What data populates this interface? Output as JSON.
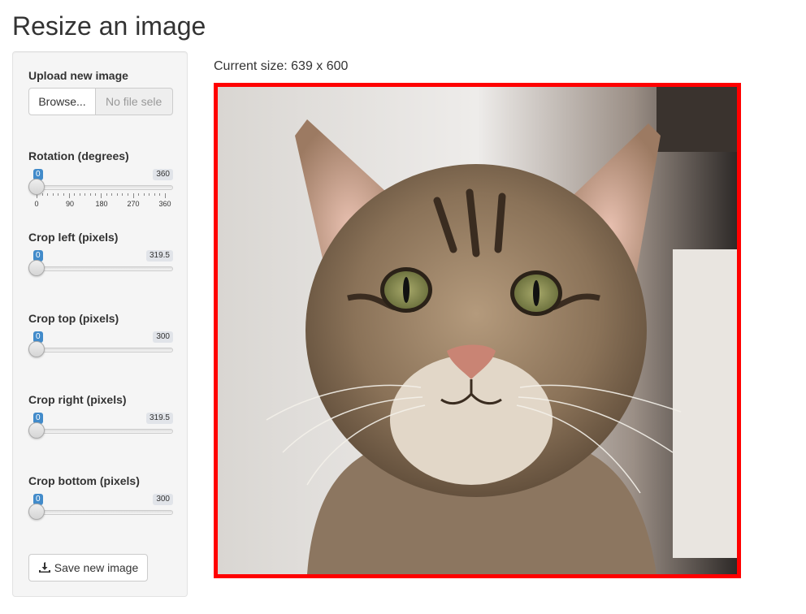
{
  "page": {
    "title": "Resize an image"
  },
  "upload": {
    "label": "Upload new image",
    "browse_label": "Browse...",
    "file_placeholder": "No file sele"
  },
  "rotation": {
    "label": "Rotation (degrees)",
    "min": "0",
    "max": "360",
    "value": 0,
    "ticks": [
      "0",
      "90",
      "180",
      "270",
      "360"
    ]
  },
  "crop_left": {
    "label": "Crop left (pixels)",
    "min": "0",
    "max": "319.5",
    "value": 0
  },
  "crop_top": {
    "label": "Crop top (pixels)",
    "min": "0",
    "max": "300",
    "value": 0
  },
  "crop_right": {
    "label": "Crop right (pixels)",
    "min": "0",
    "max": "319.5",
    "value": 0
  },
  "crop_bottom": {
    "label": "Crop bottom (pixels)",
    "min": "0",
    "max": "300",
    "value": 0
  },
  "save": {
    "label": "Save new image",
    "icon": "download-icon"
  },
  "main": {
    "size_text": "Current size: 639 x 600",
    "image_subject": "tabby-cat-photo",
    "frame_color": "#ff0000"
  },
  "colors": {
    "badge_blue": "#428bca",
    "badge_gray": "#e1e4e9"
  }
}
